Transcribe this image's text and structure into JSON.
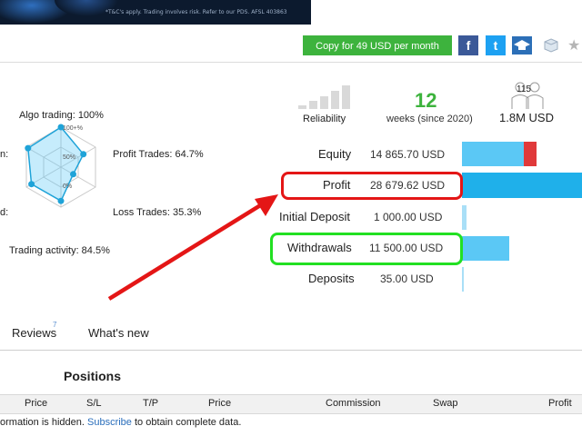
{
  "banner": {
    "disclaimer": "*T&C's apply. Trading involves risk. Refer to our PDS. AFSL 403863"
  },
  "header": {
    "copy_button_label": "Copy for 49 USD per month",
    "social": {
      "facebook_glyph": "f",
      "twitter_glyph": "t"
    },
    "icons": [
      "facebook-icon",
      "twitter-icon",
      "graduation-cap-icon",
      "cube-icon",
      "star-icon"
    ]
  },
  "radar": {
    "labels": {
      "algo": "Algo trading: 100%",
      "profit_trades": "Profit Trades: 64.7%",
      "loss_trades": "Loss Trades: 35.3%",
      "activity": "Trading activity: 84.5%",
      "left_top_partial": "n:",
      "left_bottom_partial": "d:"
    },
    "ticks": {
      "t100": "100+%",
      "t50": "50%",
      "t0": "0%"
    },
    "values": {
      "algo": 1.0,
      "profit_trades": 0.647,
      "loss_trades": 0.353,
      "activity": 0.845,
      "left_bottom": 0.85,
      "left_top": 0.95
    }
  },
  "stats": {
    "reliability_label": "Reliability",
    "weeks_value": "12",
    "weeks_label": "weeks (since 2020)",
    "subscribers_count": "115",
    "subscribers_amount": "1.8M USD"
  },
  "financials": [
    {
      "label": "Equity",
      "value": "14 865.70 USD"
    },
    {
      "label": "Profit",
      "value": "28 679.62 USD"
    },
    {
      "label": "Initial Deposit",
      "value": "1 000.00 USD"
    },
    {
      "label": "Withdrawals",
      "value": "11 500.00 USD"
    },
    {
      "label": "Deposits",
      "value": "35.00 USD"
    }
  ],
  "colors": {
    "accent_green": "#3db33d",
    "bar_blue": "#5bc8f5",
    "bar_blue_dark": "#1fb0ea",
    "bar_red": "#e0393a",
    "highlight_red": "#e41616",
    "highlight_green": "#22e022"
  },
  "tabs": {
    "reviews": "Reviews",
    "reviews_count": "7",
    "whats_new": "What's new"
  },
  "positions": {
    "title": "Positions",
    "columns": [
      "Price",
      "S/L",
      "T/P",
      "Price",
      "Commission",
      "Swap",
      "Profit"
    ],
    "hidden_prefix": "ormation is hidden. ",
    "subscribe_link": "Subscribe",
    "hidden_suffix": " to obtain complete data."
  }
}
